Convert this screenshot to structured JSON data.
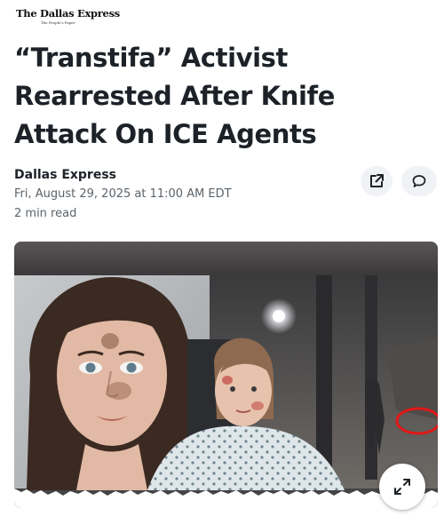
{
  "masthead": {
    "logo": "The Dallas Express",
    "tagline": "The People's Paper"
  },
  "article": {
    "headline": "“Transtifa” Activist Rearrested After Knife Attack On ICE Agents",
    "author": "Dallas Express",
    "date": "Fri, August 29, 2025 at 11:00 AM EDT",
    "read_time": "2 min read"
  },
  "icons": {
    "share": "share-icon",
    "comment": "comment-icon",
    "expand": "expand-icon"
  }
}
